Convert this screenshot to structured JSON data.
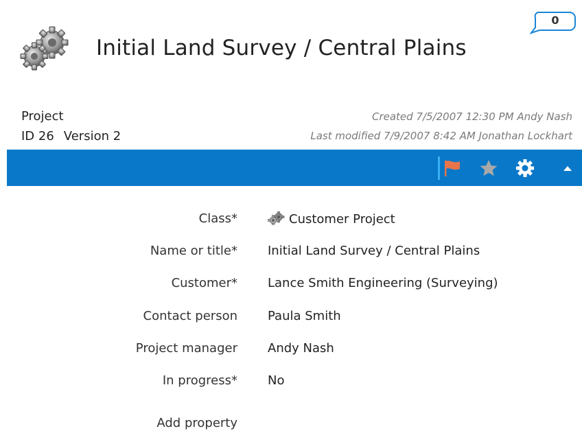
{
  "header": {
    "title": "Initial Land Survey / Central Plains",
    "icon": "gears-icon",
    "comment_count": "0"
  },
  "meta": {
    "object_type": "Project",
    "id_text": "ID 26",
    "version_text": "Version 2",
    "created": "Created 7/5/2007 12:30 PM Andy Nash",
    "modified": "Last modified 7/9/2007 8:42 AM Jonathan Lockhart"
  },
  "toolbar": {
    "accent_color": "#0a78c8",
    "flag_color": "#e8744a",
    "items": [
      {
        "name": "flag-icon"
      },
      {
        "name": "star-icon"
      },
      {
        "name": "gear-icon"
      },
      {
        "name": "collapse-icon"
      }
    ]
  },
  "properties": [
    {
      "label": "Class*",
      "value": "Customer Project",
      "icon": "gears-icon"
    },
    {
      "label": "Name or title*",
      "value": "Initial Land Survey / Central Plains"
    },
    {
      "label": "Customer*",
      "value": "Lance Smith Engineering (Surveying)"
    },
    {
      "label": "Contact person",
      "value": "Paula Smith"
    },
    {
      "label": "Project manager",
      "value": "Andy Nash"
    },
    {
      "label": "In progress*",
      "value": "No"
    }
  ],
  "add_property_label": "Add property"
}
